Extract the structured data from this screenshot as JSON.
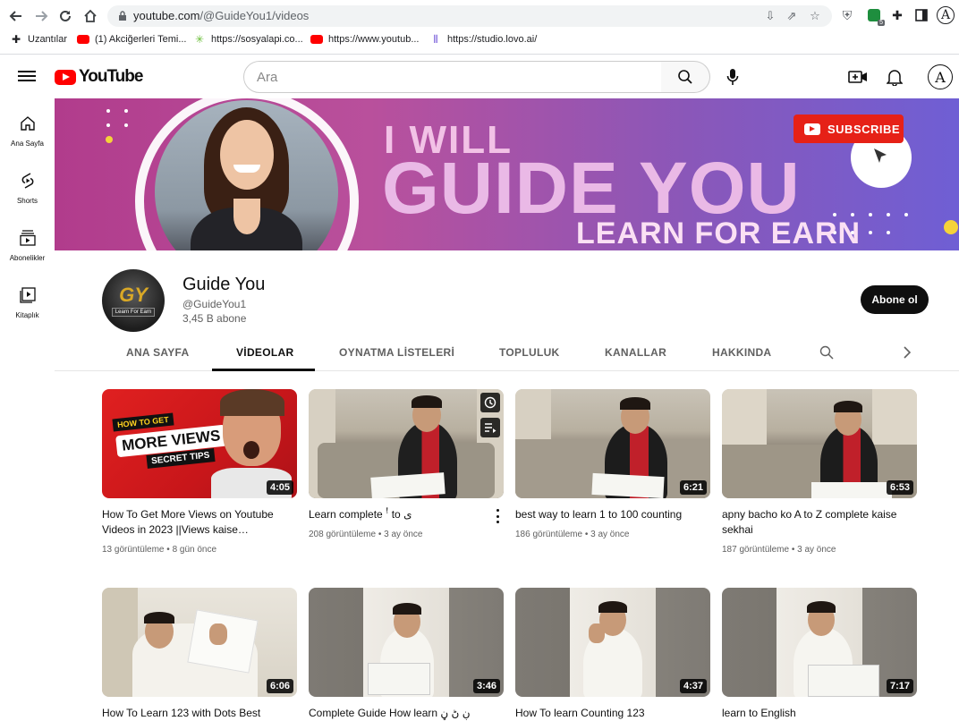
{
  "browser": {
    "url_host": "youtube.com",
    "url_path": "/@GuideYou1/videos",
    "extension_badge": "5",
    "bookmarks": [
      {
        "label": "Uzantılar"
      },
      {
        "label": "(1) Akciğerleri Temi..."
      },
      {
        "label": "https://sosyalapi.co..."
      },
      {
        "label": "https://www.youtub..."
      },
      {
        "label": "https://studio.lovo.ai/"
      }
    ]
  },
  "header": {
    "logo_text": "YouTube",
    "search_placeholder": "Ara",
    "avatar_letter": "A"
  },
  "sidebar": {
    "items": [
      {
        "label": "Ana Sayfa",
        "icon": "home-icon"
      },
      {
        "label": "Shorts",
        "icon": "shorts-icon"
      },
      {
        "label": "Abonelikler",
        "icon": "subscriptions-icon"
      },
      {
        "label": "Kitaplık",
        "icon": "library-icon"
      }
    ]
  },
  "banner": {
    "line1": "I WILL",
    "line2": "GUIDE YOU",
    "line3": "LEARN FOR EARN",
    "subscribe_badge": "SUBSCRIBE"
  },
  "channel": {
    "name": "Guide You",
    "handle": "@GuideYou1",
    "subscribers": "3,45 B abone",
    "subscribe_label": "Abone ol",
    "avatar_letters": "GY",
    "avatar_tag": "Learn For Earn"
  },
  "tabs": [
    {
      "label": "ANA SAYFA",
      "active": false
    },
    {
      "label": "VİDEOLAR",
      "active": true
    },
    {
      "label": "OYNATMA LİSTELERİ",
      "active": false
    },
    {
      "label": "TOPLULUK",
      "active": false
    },
    {
      "label": "KANALLAR",
      "active": false
    },
    {
      "label": "HAKKINDA",
      "active": false
    }
  ],
  "videos": [
    {
      "title": "How To Get More Views on Youtube Videos in 2023 ||Views kaise…",
      "duration": "4:05",
      "views": "13 görüntüleme",
      "age": "8 gün önce",
      "thumb_text1": "HOW TO GET",
      "thumb_text2": "MORE VIEWS",
      "thumb_text3": "SECRET TIPS"
    },
    {
      "title": "Learn complete ꜝ to ى",
      "duration": "",
      "views": "208 görüntüleme",
      "age": "3 ay önce"
    },
    {
      "title": "best way to learn 1 to 100 counting",
      "duration": "6:21",
      "views": "186 görüntüleme",
      "age": "3 ay önce"
    },
    {
      "title": "apny bacho ko A to Z complete kaise sekhai",
      "duration": "6:53",
      "views": "187 görüntüleme",
      "age": "3 ay önce"
    },
    {
      "title": "How To Learn 123 with Dots Best",
      "duration": "6:06"
    },
    {
      "title": "Complete Guide How learn ڹ ڻ ڼ",
      "duration": "3:46"
    },
    {
      "title": "How To learn Counting 123",
      "duration": "4:37"
    },
    {
      "title": "learn to English",
      "duration": "7:17"
    }
  ]
}
